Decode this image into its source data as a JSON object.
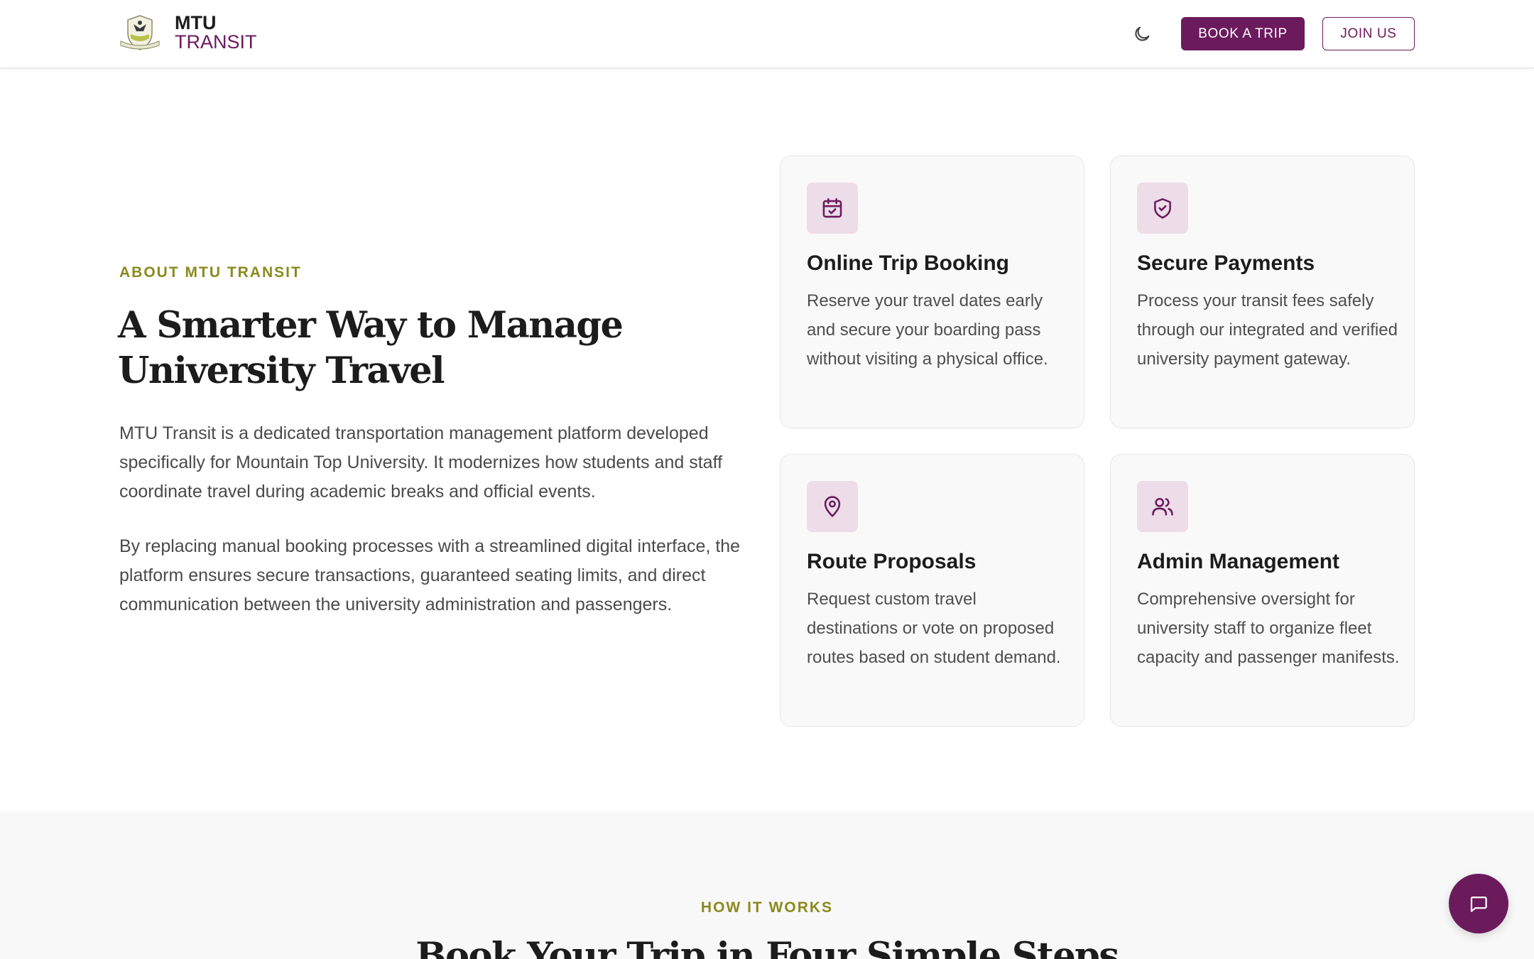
{
  "header": {
    "logo_line1": "MTU",
    "logo_line2": "TRANSIT",
    "book_label": "BOOK A TRIP",
    "join_label": "JOIN US"
  },
  "about": {
    "eyebrow": "ABOUT MTU TRANSIT",
    "heading": "A Smarter Way to Manage University Travel",
    "paragraph1": "MTU Transit is a dedicated transportation management platform developed specifically for Mountain Top University. It modernizes how students and staff coordinate travel during academic breaks and official events.",
    "paragraph2": "By replacing manual booking processes with a streamlined digital interface, the platform ensures secure transactions, guaranteed seating limits, and direct communication between the university administration and passengers."
  },
  "features": [
    {
      "icon": "calendar-check-icon",
      "title": "Online Trip Booking",
      "description": "Reserve your travel dates early and secure your boarding pass without visiting a physical office."
    },
    {
      "icon": "shield-check-icon",
      "title": "Secure Payments",
      "description": "Process your transit fees safely through our integrated and verified university payment gateway."
    },
    {
      "icon": "map-pin-icon",
      "title": "Route Proposals",
      "description": "Request custom travel destinations or vote on proposed routes based on student demand."
    },
    {
      "icon": "users-icon",
      "title": "Admin Management",
      "description": "Comprehensive oversight for university staff to organize fleet capacity and passenger manifests."
    }
  ],
  "how_it_works": {
    "eyebrow": "HOW IT WORKS",
    "heading": "Book Your Trip in Four Simple Steps"
  },
  "colors": {
    "brand": "#6b1a5c",
    "accent": "#8a8a1e",
    "icon_bg": "#ecdde8"
  }
}
